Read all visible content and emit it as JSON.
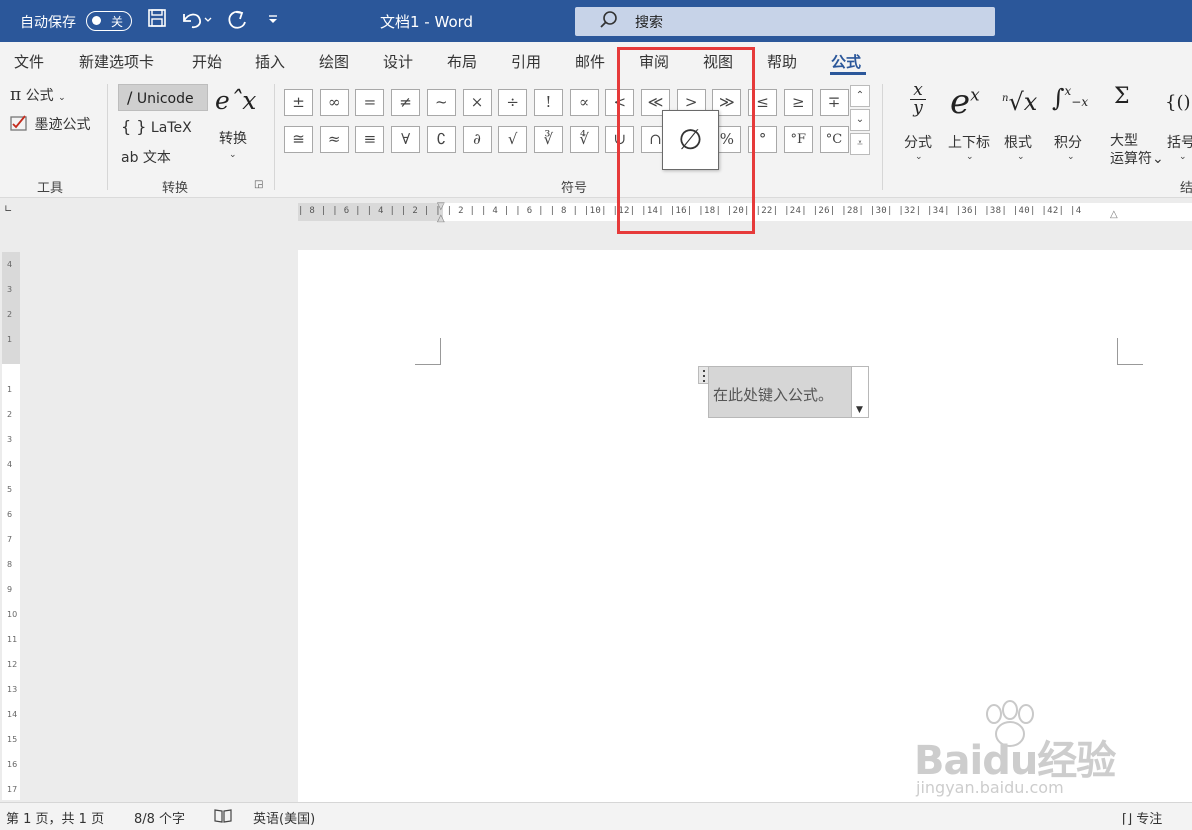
{
  "titlebar": {
    "autosave_label": "自动保存",
    "autosave_state": "关",
    "save_icon": "save-icon",
    "undo_icon": "undo-icon",
    "redo_icon": "redo-icon",
    "customize_icon": "customize-quick-access-icon",
    "document_title": "文档1  -  Word",
    "search_placeholder": "搜索",
    "accent": "#2b579a"
  },
  "tabs": [
    "文件",
    "新建选项卡",
    "开始",
    "插入",
    "绘图",
    "设计",
    "布局",
    "引用",
    "邮件",
    "审阅",
    "视图",
    "帮助",
    "公式"
  ],
  "active_tab": "公式",
  "ribbon": {
    "tools": {
      "equation_label": "公式",
      "ink_equation_label": "墨迹公式",
      "group_label": "工具"
    },
    "conversions": {
      "unicode_label": "Unicode",
      "latex_label": "LaTeX",
      "text_label": "文本",
      "convert_label": "转换",
      "group_label": "转换"
    },
    "symbols": {
      "row1": [
        "±",
        "∞",
        "=",
        "≠",
        "~",
        "×",
        "÷",
        "!",
        "∝",
        "<",
        "≪",
        ">",
        "≫",
        "≤",
        "≥",
        "∓"
      ],
      "row2": [
        "≅",
        "≈",
        "≡",
        "∀",
        "∁",
        "∂",
        "√",
        "∛",
        "∜",
        "∪",
        "∩",
        "∅",
        "%",
        "°",
        "°F",
        "°C"
      ],
      "group_label": "符号"
    },
    "structures": [
      {
        "glyph": "x/y",
        "label": "分式"
      },
      {
        "glyph": "eˣ",
        "label": "上下标"
      },
      {
        "glyph": "ⁿ√x",
        "label": "根式"
      },
      {
        "glyph": "∫",
        "label": "积分"
      },
      {
        "glyph": "Σ",
        "label": "大型\n运算符"
      },
      {
        "glyph": "{()}",
        "label": "括号"
      }
    ],
    "structures_group_label_partial": "结"
  },
  "tooltip_symbol": "∅",
  "ruler": {
    "ticks": "| 8 |  | 6 |  | 4 |  | 2 |  |    | 2 |  | 4 |  | 6 |  | 8 |  |10|  |12|  |14|  |16|  |18|  |20|  |22|  |24|  |26|  |28|  |30|  |32|  |34|  |36|  |38|  |40|  |42|  |4"
  },
  "document": {
    "equation_placeholder": "在此处键入公式。"
  },
  "statusbar": {
    "page": "第 1 页，共 1 页",
    "words": "8/8 个字",
    "language": "英语(美国)",
    "focus": "专注"
  },
  "watermark": {
    "line1": "Baidu经验",
    "line2": "jingyan.baidu.com"
  },
  "highlight_color": "#e63a3a"
}
